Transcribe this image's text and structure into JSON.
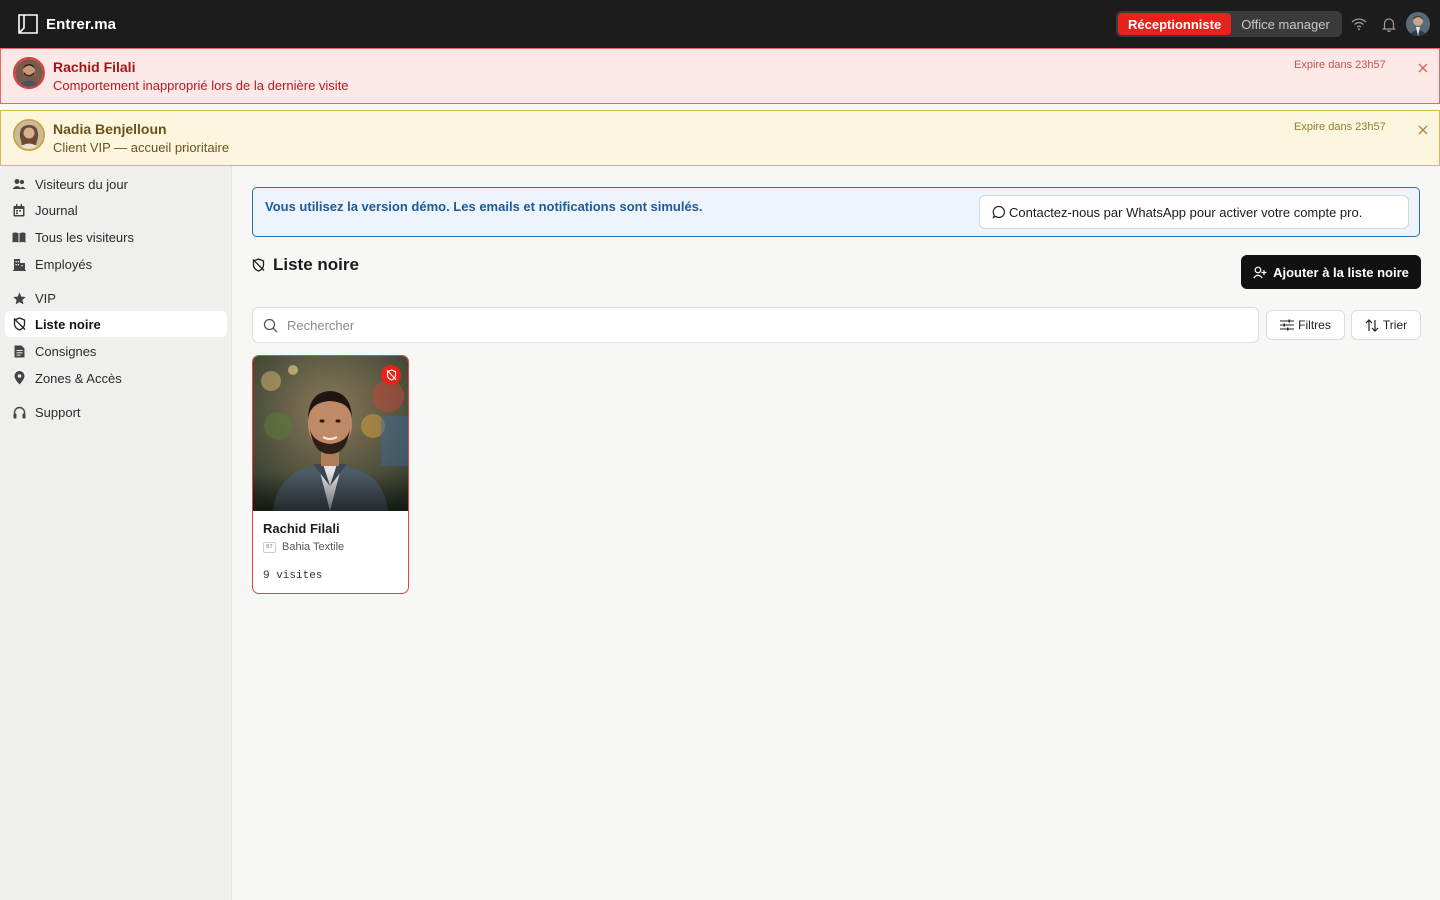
{
  "app": {
    "brand": "Entrer.ma"
  },
  "topbar": {
    "roles": [
      {
        "label": "Réceptionniste",
        "active": true
      },
      {
        "label": "Office manager",
        "active": false
      }
    ],
    "icons": [
      "wifi-icon",
      "bell-icon",
      "user-avatar"
    ]
  },
  "alerts": [
    {
      "type": "danger",
      "name": "Rachid Filali",
      "message": "Comportement inapproprié lors de la dernière visite",
      "expire": "Expire dans 23h57",
      "color": "#e46a6a"
    },
    {
      "type": "vip",
      "name": "Nadia Benjelloun",
      "message": "Client VIP — accueil prioritaire",
      "expire": "Expire dans 23h57",
      "color": "#d8b75a"
    }
  ],
  "sidebar": {
    "items": [
      {
        "label": "Visiteurs du jour",
        "icon": "users-icon"
      },
      {
        "label": "Journal",
        "icon": "calendar-icon"
      },
      {
        "label": "Tous les visiteurs",
        "icon": "book-icon"
      },
      {
        "label": "Employés",
        "icon": "building-icon"
      },
      {
        "label": "VIP",
        "icon": "star-icon"
      },
      {
        "label": "Liste noire",
        "icon": "shield-off-icon",
        "active": true
      },
      {
        "label": "Consignes",
        "icon": "document-icon"
      },
      {
        "label": "Zones & Accès",
        "icon": "map-pin-icon"
      },
      {
        "label": "Support",
        "icon": "headphones-icon"
      }
    ]
  },
  "demo": {
    "text": "Vous utilisez la version démo. Les emails et notifications sont simulés.",
    "whatsapp_label": "Contactez-nous par WhatsApp pour activer votre compte pro."
  },
  "page": {
    "title": "Liste noire",
    "add_label": "Ajouter à la liste noire",
    "search_placeholder": "Rechercher",
    "filters_label": "Filtres",
    "sort_label": "Trier"
  },
  "cards": [
    {
      "name": "Rachid Filali",
      "company": "Bahia Textile",
      "company_initials": "BT",
      "visits": "9 visites"
    }
  ],
  "colors": {
    "accent": "#e5231b",
    "demo_border": "#2e6db3",
    "dark": "#1c1c1c"
  }
}
